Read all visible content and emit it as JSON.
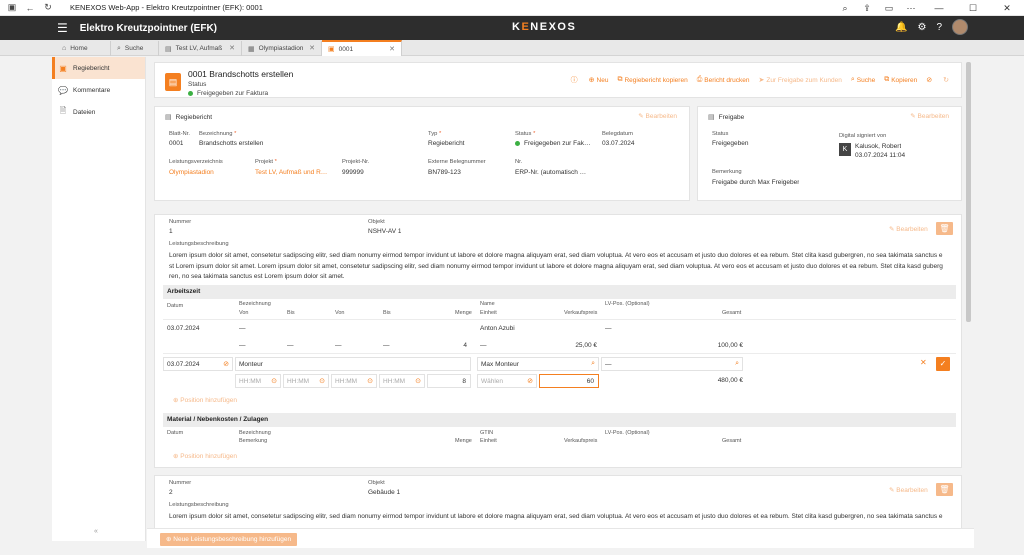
{
  "window": {
    "title": "KENEXOS Web-App - Elektro Kreutzpointner (EFK): 0001"
  },
  "appbar": {
    "company": "Elektro Kreutzpointner (EFK)",
    "logo_k": "K",
    "logo_accent": "E",
    "logo_rest": "NEXOS"
  },
  "tabs": [
    {
      "label": "Home"
    },
    {
      "label": "Suche"
    },
    {
      "label": "Test LV, Aufmaß"
    },
    {
      "label": "Olympiastadion"
    },
    {
      "label": "0001"
    }
  ],
  "sidebar": {
    "items": [
      {
        "label": "Regiebericht"
      },
      {
        "label": "Kommentare"
      },
      {
        "label": "Dateien"
      }
    ],
    "collapse": "«"
  },
  "header": {
    "title": "0001 Brandschotts erstellen",
    "status_label": "Status",
    "status_value": "Freigegeben zur Faktura",
    "actions": {
      "new": "Neu",
      "copy": "Regiebericht kopieren",
      "print": "Bericht drucken",
      "release": "Zur Freigabe zum Kunden",
      "search": "Suche",
      "clone": "Kopieren"
    }
  },
  "regiebericht": {
    "title": "Regiebericht",
    "edit": "Bearbeiten",
    "fields": {
      "blatt_nr_label": "Blatt-Nr.",
      "blatt_nr": "0001",
      "bezeichnung_label": "Bezeichnung",
      "bezeichnung": "Brandschotts erstellen",
      "typ_label": "Typ",
      "typ": "Regiebericht",
      "status_label": "Status",
      "status": "Freigegeben zur Fak…",
      "belegdatum_label": "Belegdatum",
      "belegdatum": "03.07.2024",
      "lv_label": "Leistungsverzeichnis",
      "lv": "Olympiastadion",
      "projekt_label": "Projekt",
      "projekt": "Test LV, Aufmaß und R…",
      "projekt_nr_label": "Projekt-Nr.",
      "projekt_nr": "999999",
      "ext_beleg_label": "Externe Belegnummer",
      "ext_beleg": "BN789-123",
      "nr_label": "Nr.",
      "nr": "ERP-Nr. (automatisch …"
    }
  },
  "freigabe": {
    "title": "Freigabe",
    "edit": "Bearbeiten",
    "status_label": "Status",
    "status": "Freigegeben",
    "signed_label": "Digital signiert von",
    "signed_by": "Kalusok, Robert",
    "signed_date": "03.07.2024 11:04",
    "remark_label": "Bemerkung",
    "remark": "Freigabe durch Max Freigeber"
  },
  "position1": {
    "nummer_label": "Nummer",
    "nummer": "1",
    "objekt_label": "Objekt",
    "objekt": "NSHV-AV 1",
    "edit": "Bearbeiten",
    "desc_label": "Leistungsbeschreibung",
    "desc_lines": [
      "Lorem ipsum dolor sit amet, consetetur sadipscing elitr, sed diam nonumy eirmod tempor invidunt ut labore et dolore magna aliquyam erat, sed diam voluptua. At vero eos et accusam et justo duo dolores et ea rebum. Stet clita kasd gubergren, no sea takimata sanctus e",
      "st Lorem ipsum dolor sit amet. Lorem ipsum dolor sit amet, consetetur sadipscing elitr, sed diam nonumy eirmod tempor invidunt ut labore et dolore magna aliquyam erat, sed diam voluptua. At vero eos et accusam et justo duo dolores et ea rebum. Stet clita kasd guberg",
      "ren, no sea takimata sanctus est Lorem ipsum dolor sit amet."
    ],
    "arbeitszeit": {
      "title": "Arbeitszeit",
      "col_datum": "Datum",
      "col_bezeichnung": "Bezeichnung",
      "col_von": "Von",
      "col_bis": "Bis",
      "col_von2": "Von",
      "col_bis2": "Bis",
      "col_menge": "Menge",
      "col_name": "Name",
      "col_einheit": "Einheit",
      "col_vkpreis": "Verkaufspreis",
      "col_lvpos": "LV-Pos. (Optional)",
      "col_gesamt": "Gesamt",
      "row": {
        "datum": "03.07.2024",
        "bezeichnung": "—",
        "von": "—",
        "bis": "—",
        "von2": "—",
        "bis2": "—",
        "menge": "4",
        "name": "Anton Azubi",
        "einheit": "—",
        "preis": "25,00 €",
        "lvpos": "—",
        "gesamt": "100,00 €"
      },
      "edit_row": {
        "datum": "03.07.2024",
        "bezeichnung": "Monteur",
        "time_placeholder": "HH:MM",
        "menge": "8",
        "name": "Max Monteur",
        "einheit": "Wählen",
        "preis": "60",
        "lvpos": "—",
        "gesamt": "480,00 €"
      },
      "add": "Position hinzufügen"
    },
    "material": {
      "title": "Material / Nebenkosten / Zulagen",
      "col_datum": "Datum",
      "col_bezeichnung": "Bezeichnung",
      "col_bemerkung": "Bemerkung",
      "col_menge": "Menge",
      "col_gtin": "GTIN",
      "col_einheit": "Einheit",
      "col_vkpreis": "Verkaufspreis",
      "col_lvpos": "LV-Pos. (Optional)",
      "col_gesamt": "Gesamt",
      "add": "Position hinzufügen"
    }
  },
  "position2": {
    "nummer_label": "Nummer",
    "nummer": "2",
    "objekt_label": "Objekt",
    "objekt": "Gebäude 1",
    "edit": "Bearbeiten",
    "desc_label": "Leistungsbeschreibung",
    "desc_lines": [
      "Lorem ipsum dolor sit amet, consetetur sadipscing elitr, sed diam nonumy eirmod tempor invidunt ut labore et dolore magna aliquyam erat, sed diam voluptua. At vero eos et accusam et justo duo dolores et ea rebum. Stet clita kasd gubergren, no sea takimata sanctus e"
    ]
  },
  "bottom": {
    "new_button": "Neue Leistungsbeschreibung hinzufügen"
  },
  "colors": {
    "accent": "#f47f20",
    "accent_light": "#f6b98a",
    "appbar": "#2d2d2d",
    "status_green": "#3cb043"
  }
}
